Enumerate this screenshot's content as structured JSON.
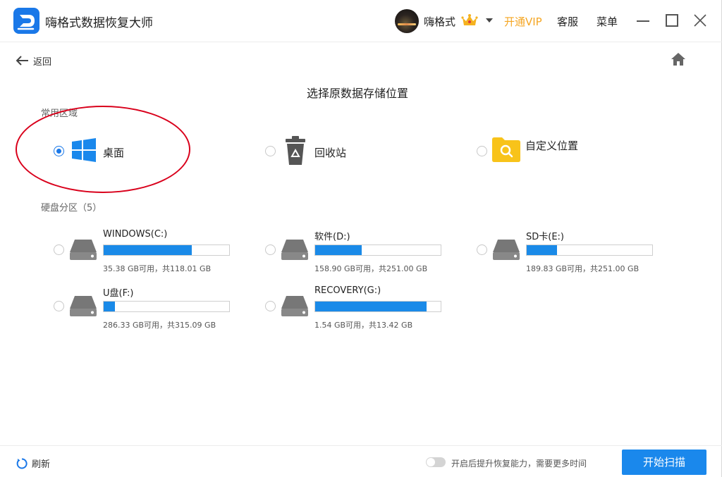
{
  "app": {
    "title": "嗨格式数据恢复大师"
  },
  "user": {
    "name": "嗨格式",
    "vip_label": "开通VIP",
    "service_label": "客服",
    "menu_label": "菜单"
  },
  "nav": {
    "back_label": "返回",
    "icons": {
      "back": "arrow-left-icon",
      "home": "home-icon"
    }
  },
  "page": {
    "title": "选择原数据存储位置"
  },
  "common_area": {
    "label": "常用区域",
    "items": [
      {
        "label": "桌面",
        "icon": "windows-icon",
        "selected": true
      },
      {
        "label": "回收站",
        "icon": "recycle-bin-icon",
        "selected": false
      },
      {
        "label": "自定义位置",
        "icon": "folder-search-icon",
        "selected": false
      }
    ]
  },
  "disks": {
    "label": "硬盘分区（5）",
    "items": [
      {
        "name": "WINDOWS(C:)",
        "info": "35.38 GB可用，共118.01 GB",
        "used_fraction": 0.7
      },
      {
        "name": "软件(D:)",
        "info": "158.90 GB可用，共251.00 GB",
        "used_fraction": 0.37
      },
      {
        "name": "SD卡(E:)",
        "info": "189.83 GB可用，共251.00 GB",
        "used_fraction": 0.24
      },
      {
        "name": "U盘(F:)",
        "info": "286.33 GB可用，共315.09 GB",
        "used_fraction": 0.09
      },
      {
        "name": "RECOVERY(G:)",
        "info": "1.54 GB可用，共13.42 GB",
        "used_fraction": 0.89
      }
    ]
  },
  "footer": {
    "refresh_label": "刷新",
    "toggle_label": "开启后提升恢复能力，需要更多时间",
    "toggle_on": false,
    "scan_label": "开始扫描"
  },
  "colors": {
    "accent": "#1a88ec",
    "vip": "#f5a623",
    "highlight": "#d9001b",
    "bar_fill": "#1a8ae8"
  }
}
